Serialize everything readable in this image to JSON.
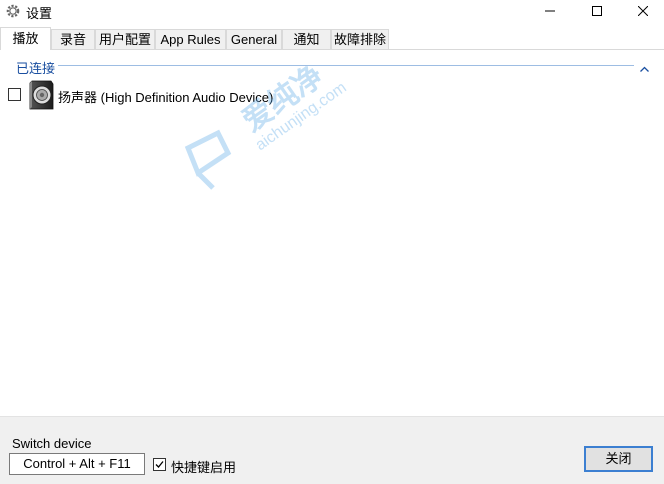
{
  "window": {
    "title": "设置",
    "app_icon": "gear-icon",
    "controls": [
      "minimize-icon",
      "maximize-icon",
      "close-icon"
    ]
  },
  "tabs": [
    {
      "label": "播放",
      "active": true
    },
    {
      "label": "录音",
      "active": false
    },
    {
      "label": "用户配置",
      "active": false
    },
    {
      "label": "App Rules",
      "active": false
    },
    {
      "label": "General",
      "active": false
    },
    {
      "label": "通知",
      "active": false
    },
    {
      "label": "故障排除",
      "active": false
    }
  ],
  "playback": {
    "group_label": "已连接",
    "group_chevron": "chevron-up-icon",
    "devices": [
      {
        "name": "扬声器 (High Definition Audio Device)",
        "icon": "speaker-icon",
        "checked": false
      }
    ]
  },
  "watermark": {
    "big": "爱纯净",
    "small": "aichunjing.com"
  },
  "footer": {
    "switch_label": "Switch device",
    "hotkey_value": "Control + Alt + F11",
    "hotkey_enabled_label": "快捷键启用",
    "hotkey_enabled": true,
    "close_button": "关闭"
  },
  "colors": {
    "group_header": "#1a4fa0",
    "accent_border": "#3c7fd1",
    "footer_bg": "#f0f0f0"
  }
}
